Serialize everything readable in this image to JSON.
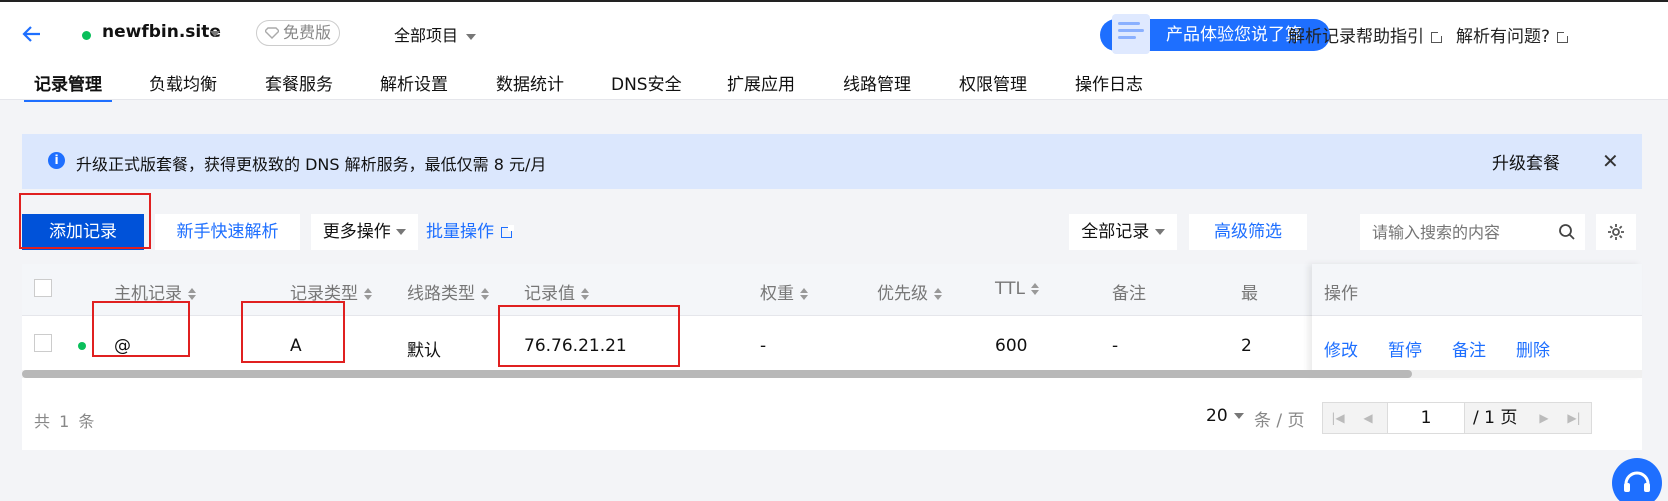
{
  "header": {
    "domain": "newfbin.site",
    "plan_badge": "免费版",
    "project_selector": "全部项目",
    "experience_banner": "产品体验您说了算",
    "help_guide": "解析记录帮助指引",
    "issue_link": "解析有问题?"
  },
  "tabs": [
    "记录管理",
    "负载均衡",
    "套餐服务",
    "解析设置",
    "数据统计",
    "DNS安全",
    "扩展应用",
    "线路管理",
    "权限管理",
    "操作日志"
  ],
  "notice": {
    "message": "升级正式版套餐，获得更极致的 DNS 解析服务，最低仅需 8 元/月",
    "action": "升级套餐",
    "close": "✕"
  },
  "toolbar": {
    "add_record": "添加记录",
    "quick_resolve": "新手快速解析",
    "more_actions": "更多操作",
    "batch_actions": "批量操作",
    "filter_all": "全部记录",
    "advanced_filter": "高级筛选",
    "search_placeholder": "请输入搜索的内容"
  },
  "table": {
    "columns": [
      "主机记录",
      "记录类型",
      "线路类型",
      "记录值",
      "权重",
      "优先级",
      "TTL",
      "备注",
      "最"
    ],
    "ops_header": "操作",
    "rows": [
      {
        "host": "@",
        "type": "A",
        "line": "默认",
        "value": "76.76.21.21",
        "weight": "-",
        "priority": "",
        "ttl": "600",
        "remark": "-",
        "last": "2",
        "status": "enabled"
      }
    ],
    "ops": [
      "修改",
      "暂停",
      "备注",
      "删除"
    ]
  },
  "pagination": {
    "total": "共 1 条",
    "page_size": "20",
    "per_page": "条 / 页",
    "current_page": "1",
    "total_pages": "/ 1 页"
  },
  "colors": {
    "primary": "#0052d9",
    "accent": "#1e6fff",
    "highlight": "#e02020",
    "status_ok": "#0abf5b"
  }
}
